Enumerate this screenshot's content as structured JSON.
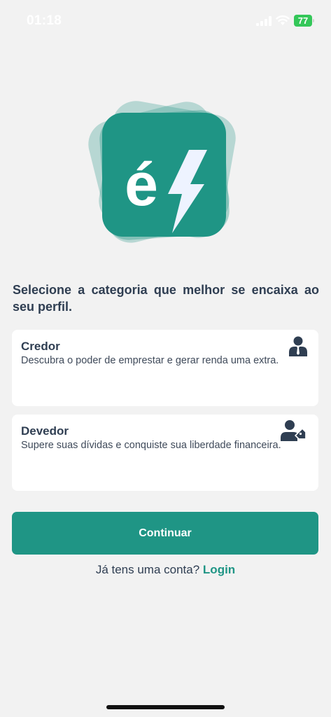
{
  "status_bar": {
    "time": "01:18",
    "battery_level": "77",
    "icons": [
      "signal-icon",
      "wifi-icon",
      "battery-icon"
    ],
    "battery_color": "#34c759"
  },
  "logo": {
    "letter": "é",
    "icon": "lightning-bolt-icon",
    "color": "#1f9585"
  },
  "prompt": "Selecione a categoria que melhor se encaixa ao seu perfil.",
  "options": [
    {
      "title": "Credor",
      "description": "Descubra o poder de emprestar e gerar renda uma extra.",
      "icon": "businessman-icon"
    },
    {
      "title": "Devedor",
      "description": "Supere suas dívidas e conquiste sua liberdade financeira.",
      "icon": "user-tag-icon"
    }
  ],
  "continue_label": "Continuar",
  "login": {
    "prompt": "Já tens uma conta?",
    "link": "Login"
  },
  "colors": {
    "accent": "#1f9585",
    "text": "#2f3e52",
    "background": "#f2f2f2"
  }
}
